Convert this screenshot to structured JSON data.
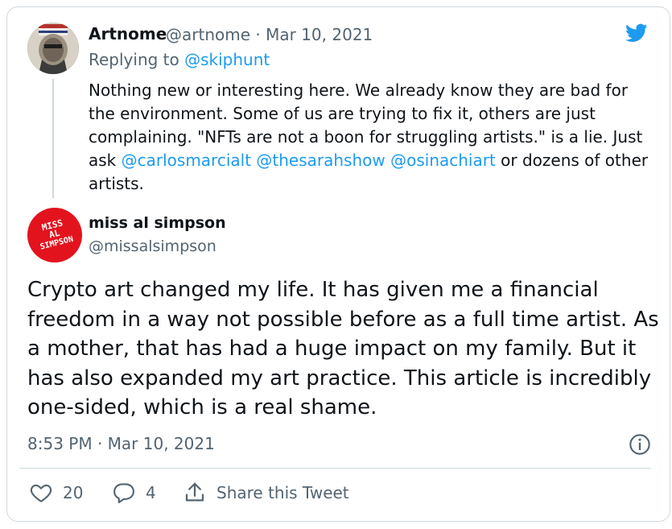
{
  "parent": {
    "name": "Artnome",
    "handle": "@artnome",
    "separator": "·",
    "date": "Mar 10, 2021",
    "replying_prefix": "Replying to",
    "replying_to": "@skiphunt",
    "text_part1": "Nothing new or interesting here. We already know they are bad for the environment. Some of us are trying to fix it, others are just complaining. \"NFTs are not a boon for struggling artists.\" is a lie. Just ask",
    "mention1": "@carlosmarcialt",
    "mention2": "@thesarahshow",
    "mention3": "@osinachiart",
    "text_part2": "or dozens of other artists."
  },
  "tweet": {
    "author_name": "miss al simpson",
    "author_handle": "@missalsimpson",
    "avatar_text": [
      "MISS",
      "AL",
      "SIMPSON"
    ],
    "text": "Crypto art changed my life. It has given me a financial freedom in a way not possible before as a full time artist. As a mother, that has had a huge impact on my family. But it has also expanded my art practice. This article is incredibly one-sided, which is a real shame.",
    "time": "8:53 PM",
    "separator": "·",
    "date": "Mar 10, 2021"
  },
  "actions": {
    "likes": "20",
    "replies": "4",
    "share_label": "Share this Tweet"
  },
  "icons": {
    "brand": "twitter-bird-icon",
    "info": "info-icon",
    "like": "heart-icon",
    "reply": "comment-icon",
    "share": "share-icon"
  },
  "colors": {
    "accent": "#1d9bf0",
    "secondary_text": "#536471",
    "border": "#cfd9de",
    "avatar_red": "#e3131e"
  }
}
